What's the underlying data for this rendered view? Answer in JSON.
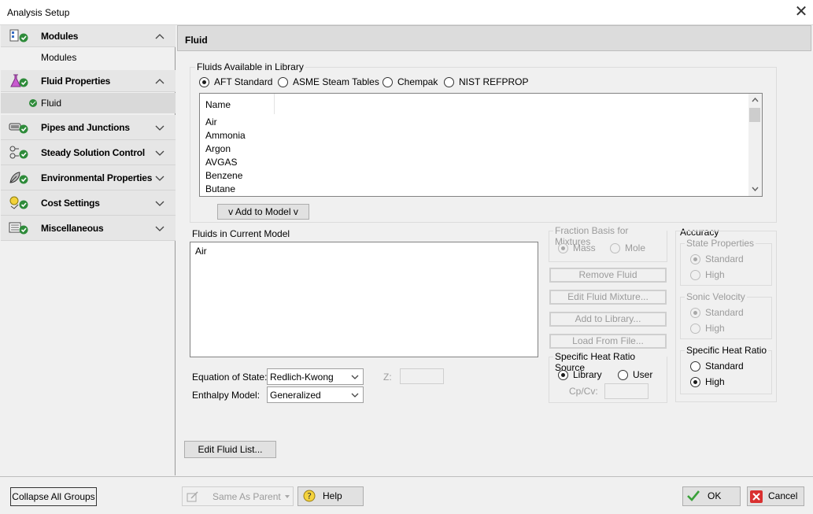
{
  "window": {
    "title": "Analysis Setup"
  },
  "sidebar": {
    "groups": [
      {
        "label": "Modules",
        "icon": "modules-icon",
        "expanded": true,
        "items": [
          {
            "label": "Modules",
            "checked": false
          }
        ]
      },
      {
        "label": "Fluid Properties",
        "icon": "flask-icon",
        "expanded": true,
        "items": [
          {
            "label": "Fluid",
            "checked": true,
            "selected": true
          }
        ]
      },
      {
        "label": "Pipes and Junctions",
        "icon": "pipe-icon",
        "expanded": false
      },
      {
        "label": "Steady Solution Control",
        "icon": "solution-control-icon",
        "expanded": false
      },
      {
        "label": "Environmental Properties",
        "icon": "environment-icon",
        "expanded": false
      },
      {
        "label": "Cost Settings",
        "icon": "cost-icon",
        "expanded": false
      },
      {
        "label": "Miscellaneous",
        "icon": "misc-icon",
        "expanded": false
      }
    ]
  },
  "main": {
    "title": "Fluid",
    "library": {
      "legend": "Fluids Available in Library",
      "sources": [
        {
          "label": "AFT Standard",
          "selected": true
        },
        {
          "label": "ASME Steam Tables",
          "selected": false
        },
        {
          "label": "Chempak",
          "selected": false
        },
        {
          "label": "NIST REFPROP",
          "selected": false
        }
      ],
      "column_header": "Name",
      "fluids": [
        "Air",
        "Ammonia",
        "Argon",
        "AVGAS",
        "Benzene",
        "Butane"
      ],
      "add_button": "v  Add to Model  v"
    },
    "current_model": {
      "label": "Fluids in Current Model",
      "fluids": [
        "Air"
      ]
    },
    "fraction_basis": {
      "legend": "Fraction Basis for Mixtures",
      "options": [
        {
          "label": "Mass",
          "selected": true
        },
        {
          "label": "Mole",
          "selected": false
        }
      ]
    },
    "actions": {
      "remove": "Remove Fluid",
      "edit_mixture": "Edit Fluid Mixture...",
      "add_library": "Add to Library...",
      "load_file": "Load From File..."
    },
    "heat_ratio_source": {
      "legend": "Specific Heat Ratio Source",
      "options": [
        {
          "label": "Library",
          "selected": true
        },
        {
          "label": "User",
          "selected": false
        }
      ],
      "cp_cv_label": "Cp/Cv:",
      "cp_cv_value": ""
    },
    "accuracy": {
      "label": "Accuracy",
      "state_properties": {
        "legend": "State Properties",
        "options": [
          {
            "label": "Standard",
            "selected": true
          },
          {
            "label": "High",
            "selected": false
          }
        ]
      },
      "sonic_velocity": {
        "legend": "Sonic Velocity",
        "options": [
          {
            "label": "Standard",
            "selected": true
          },
          {
            "label": "High",
            "selected": false
          }
        ]
      },
      "specific_heat_ratio": {
        "legend": "Specific Heat Ratio",
        "options": [
          {
            "label": "Standard",
            "selected": false
          },
          {
            "label": "High",
            "selected": true
          }
        ]
      }
    },
    "equation_of_state": {
      "label": "Equation of State:",
      "value": "Redlich-Kwong"
    },
    "z_field": {
      "label": "Z:",
      "value": ""
    },
    "enthalpy_model": {
      "label": "Enthalpy Model:",
      "value": "Generalized"
    },
    "edit_fluid_list": "Edit Fluid List..."
  },
  "bottom": {
    "collapse_all": "Collapse All Groups",
    "same_as_parent": "Same As Parent",
    "help": "Help",
    "ok": "OK",
    "cancel": "Cancel"
  }
}
